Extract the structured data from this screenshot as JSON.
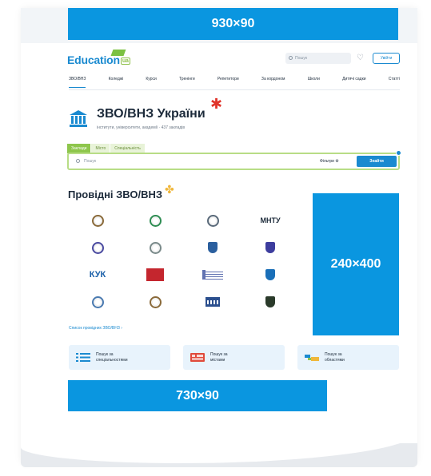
{
  "ads": {
    "top": "930×90",
    "side": "240×400",
    "bottom": "730×90"
  },
  "header": {
    "logo_text": "Education",
    "logo_suffix": "ua",
    "search_placeholder": "Пошук",
    "login_label": "Увійти"
  },
  "nav": [
    "ЗВО/ВНЗ",
    "Коледжі",
    "Курси",
    "Тренінги",
    "Репетитори",
    "За кордоном",
    "Школи",
    "Дитячі садки",
    "Статті"
  ],
  "title": {
    "heading": "ЗВО/ВНЗ України",
    "subtitle": "інститути, університети, академії · 437 закладів"
  },
  "search": {
    "tabs": [
      "Заклади",
      "Місто",
      "Спеціальність"
    ],
    "placeholder": "Пошук",
    "filters_label": "Фільтри",
    "find_label": "Знайти"
  },
  "leading": {
    "heading": "Провідні ЗВО/ВНЗ",
    "logos": [
      {
        "label": "",
        "icon": "seal-icon",
        "color": "#8a6a3a"
      },
      {
        "label": "",
        "icon": "seal-icon",
        "color": "#2f8d53"
      },
      {
        "label": "",
        "icon": "seal-icon",
        "color": "#5a6a7a"
      },
      {
        "label": "МНТУ",
        "icon": "text-logo",
        "color": "#1c2a3a"
      },
      {
        "label": "",
        "icon": "seal-icon",
        "color": "#4a4aa0"
      },
      {
        "label": "",
        "icon": "seal-icon",
        "color": "#7a8a8a"
      },
      {
        "label": "",
        "icon": "shield-icon",
        "color": "#2b5f9e"
      },
      {
        "label": "",
        "icon": "shield-icon",
        "color": "#3d3d9e"
      },
      {
        "label": "КУК",
        "icon": "text-logo",
        "color": "#1a5fa8"
      },
      {
        "label": "",
        "icon": "flag-icon",
        "color": "#c4262e"
      },
      {
        "label": "",
        "icon": "book-icon",
        "color": "#3a4f9e"
      },
      {
        "label": "",
        "icon": "shield-icon",
        "color": "#1a6fb8"
      },
      {
        "label": "",
        "icon": "seal-icon",
        "color": "#4a7ab0"
      },
      {
        "label": "",
        "icon": "seal-icon",
        "color": "#8a6a3a"
      },
      {
        "label": "",
        "icon": "building-icon",
        "color": "#2b4f8e"
      },
      {
        "label": "",
        "icon": "shield-icon",
        "color": "#2a3a2a"
      }
    ],
    "all_link": "Список провідних ЗВО/ВНЗ ›"
  },
  "filters": [
    {
      "line1": "Пошук за",
      "line2": "спеціальностями",
      "icon": "list-icon",
      "color": "#1a8ad0"
    },
    {
      "line1": "Пошук за",
      "line2": "містами",
      "icon": "map-icon",
      "color": "#e04a3b"
    },
    {
      "line1": "Пошук за",
      "line2": "областями",
      "icon": "region-icon",
      "color": "#f0b73b"
    }
  ]
}
